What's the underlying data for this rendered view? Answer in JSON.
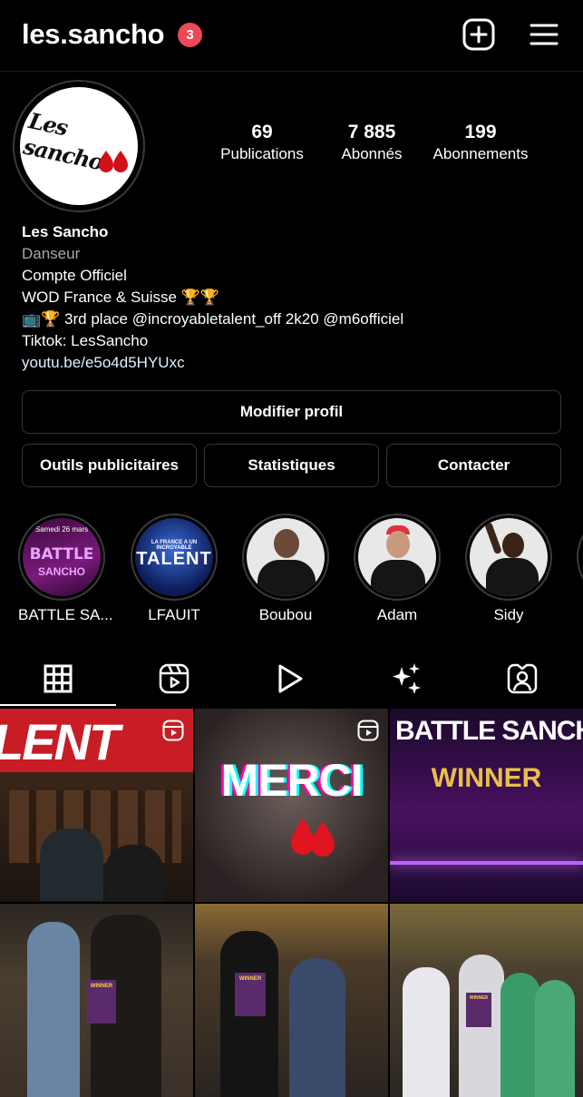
{
  "header": {
    "username": "les.sancho",
    "notification_count": "3"
  },
  "profile": {
    "stats": [
      {
        "value": "69",
        "label": "Publications"
      },
      {
        "value": "7 885",
        "label": "Abonnés"
      },
      {
        "value": "199",
        "label": "Abonnements"
      }
    ],
    "avatar_text": "Les sancho",
    "name": "Les Sancho",
    "category": "Danseur",
    "bio_lines": [
      "Compte Officiel",
      "WOD France & Suisse 🏆🏆",
      "📺🏆 3rd place @incroyabletalent_off 2k20 @m6officiel",
      "Tiktok: LesSancho"
    ],
    "link": "youtu.be/e5o4d5HYUxc"
  },
  "buttons": {
    "edit_profile": "Modifier profil",
    "ad_tools": "Outils publicitaires",
    "insights": "Statistiques",
    "contact": "Contacter"
  },
  "highlights": [
    {
      "label": "BATTLE SA...",
      "cover_top": "Samedi 26 mars",
      "cover_main": "BATTLE",
      "cover_sub": "SANCHO"
    },
    {
      "label": "LFAUIT",
      "cover_top": "LA FRANCE A UN INCROYABLE",
      "cover_main": "TALENT"
    },
    {
      "label": "Boubou"
    },
    {
      "label": "Adam"
    },
    {
      "label": "Sidy"
    }
  ],
  "tabs": [
    "grid",
    "reels",
    "videos",
    "collab",
    "tagged"
  ],
  "posts": [
    {
      "overlay": "LENT",
      "reel": true
    },
    {
      "overlay": "MERCI",
      "reel": true
    },
    {
      "overlay": "BATTLE SANCHO",
      "sub": "WINNER",
      "reel": false
    },
    {
      "overlay": "WINNER",
      "reel": false
    },
    {
      "overlay": "WINNER",
      "reel": false
    },
    {
      "overlay": "WINNER",
      "reel": false
    }
  ],
  "colors": {
    "badge": "#ed4956",
    "background": "#000000",
    "border": "#363636",
    "link": "#e0f1ff"
  }
}
